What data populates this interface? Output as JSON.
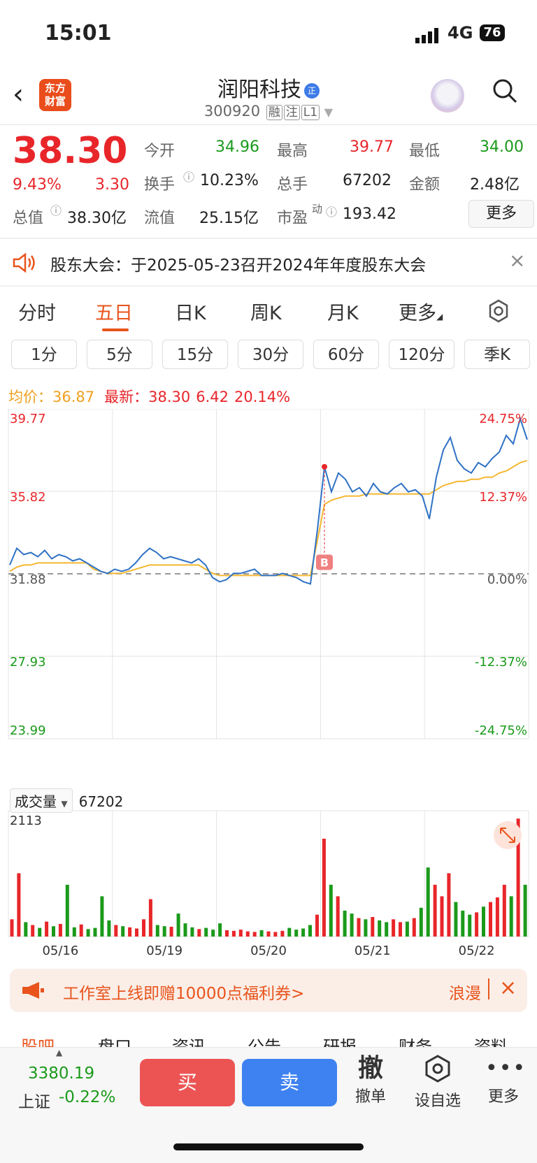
{
  "status": {
    "time": "15:01",
    "network": "4G",
    "battery": "76"
  },
  "header": {
    "logo_line1": "东方",
    "logo_line2": "财富",
    "title": "润阳科技",
    "title_badge": "正",
    "code": "300920",
    "tags": [
      "融",
      "注",
      "L1"
    ]
  },
  "quote": {
    "price": "38.30",
    "change_pct": "9.43%",
    "change": "3.30",
    "total_value_label": "总值",
    "total_value": "38.30亿",
    "open_label": "今开",
    "open": "34.96",
    "high_label": "最高",
    "high": "39.77",
    "low_label": "最低",
    "low": "34.00",
    "turnover_label": "换手",
    "turnover": "10.23%",
    "volume_label": "总手",
    "volume": "67202",
    "amount_label": "金额",
    "amount": "2.48亿",
    "float_label": "流值",
    "float_value": "25.15亿",
    "pe_label": "市盈",
    "pe_sup": "动",
    "pe": "193.42",
    "more": "更多"
  },
  "notice": {
    "text": "股东大会：于2025-05-23召开2024年年度股东大会"
  },
  "tabs": [
    "分时",
    "五日",
    "日K",
    "周K",
    "月K",
    "更多"
  ],
  "active_tab": "五日",
  "subtabs": [
    "1分",
    "5分",
    "15分",
    "30分",
    "60分",
    "120分",
    "季K"
  ],
  "legend": {
    "avg_label": "均价：",
    "avg": "36.87",
    "last_label": "最新：",
    "last": "38.30",
    "last_change": "6.42",
    "last_pct": "20.14%"
  },
  "colors": {
    "up": "#e8262a",
    "down": "#1b9a1b",
    "price_line": "#2f72c4",
    "avg_line": "#f5b731",
    "accent": "#e8541c"
  },
  "chart_data": {
    "type": "line",
    "title": "",
    "y_left_ticks": [
      "39.77",
      "35.82",
      "31.88",
      "27.93",
      "23.99"
    ],
    "y_right_ticks": [
      "24.75%",
      "12.37%",
      "0.00%",
      "-12.37%",
      "-24.75%"
    ],
    "ylim": [
      23.99,
      39.77
    ],
    "prev_close": 31.88,
    "x_labels": [
      "05/16",
      "05/19",
      "05/20",
      "05/21",
      "05/22"
    ],
    "series": [
      {
        "values": [
          32.3,
          33.1,
          32.8,
          32.9,
          32.7,
          33.0,
          32.6,
          32.8,
          32.7,
          32.5,
          32.6,
          32.4,
          32.2,
          32.0,
          31.9,
          32.1,
          32.0,
          32.1,
          32.4,
          32.8,
          33.1,
          32.9,
          32.6,
          32.7,
          32.6,
          32.5,
          32.4,
          32.6,
          32.3,
          31.7,
          31.5,
          31.6,
          31.9,
          31.9,
          32.0,
          32.1,
          31.8,
          31.8,
          31.8,
          31.9,
          31.8,
          31.7,
          31.5,
          31.4,
          34.0,
          37.0,
          35.8,
          36.7,
          36.4,
          35.8,
          36.0,
          35.6,
          36.2,
          35.8,
          35.7,
          36.0,
          36.2,
          35.8,
          35.9,
          35.6,
          34.5,
          36.5,
          37.8,
          38.4,
          37.3,
          36.9,
          36.7,
          37.2,
          37.0,
          37.4,
          37.7,
          38.5,
          38.1,
          39.3,
          38.3
        ]
      },
      {
        "values": [
          32.0,
          32.2,
          32.3,
          32.3,
          32.4,
          32.4,
          32.4,
          32.4,
          32.4,
          32.4,
          32.4,
          32.4,
          32.1,
          32.0,
          31.9,
          31.9,
          31.9,
          32.0,
          32.1,
          32.2,
          32.3,
          32.3,
          32.3,
          32.3,
          32.3,
          32.3,
          32.3,
          32.3,
          32.1,
          31.9,
          31.8,
          31.8,
          31.8,
          31.8,
          31.8,
          31.8,
          31.8,
          31.8,
          31.8,
          31.8,
          31.8,
          31.8,
          31.8,
          31.8,
          33.5,
          35.2,
          35.4,
          35.5,
          35.6,
          35.6,
          35.6,
          35.7,
          35.7,
          35.7,
          35.7,
          35.7,
          35.7,
          35.7,
          35.7,
          35.7,
          35.7,
          35.9,
          36.1,
          36.2,
          36.3,
          36.3,
          36.4,
          36.4,
          36.5,
          36.5,
          36.7,
          36.8,
          37.0,
          37.2,
          37.3
        ]
      }
    ],
    "marker": "B"
  },
  "volume": {
    "label": "成交量",
    "total": "67202",
    "max_tick": "2113",
    "chart_data": {
      "type": "bar",
      "ylim": [
        0,
        2113
      ],
      "values": [
        300,
        1100,
        250,
        200,
        150,
        260,
        180,
        220,
        900,
        160,
        210,
        130,
        150,
        700,
        280,
        200,
        180,
        160,
        140,
        300,
        650,
        200,
        180,
        170,
        400,
        230,
        160,
        130,
        150,
        120,
        230,
        110,
        100,
        120,
        90,
        80,
        110,
        90,
        80,
        100,
        150,
        120,
        140,
        200,
        380,
        1700,
        900,
        700,
        450,
        400,
        320,
        300,
        340,
        280,
        250,
        300,
        250,
        260,
        320,
        500,
        1200,
        900,
        700,
        1100,
        600,
        450,
        380,
        420,
        520,
        600,
        680,
        900,
        700,
        2050,
        900
      ]
    }
  },
  "banner": {
    "text": "工作室上线即赠10000点福利券>",
    "brand": "浪漫"
  },
  "bottom_tabs": [
    "股吧",
    "盘口",
    "资讯",
    "公告",
    "研报",
    "财务",
    "资料"
  ],
  "bottom_bar": {
    "index_value": "3380.19",
    "index_name": "上证",
    "index_change": "-0.22%",
    "buy": "买",
    "sell": "卖",
    "cancel_icon": "撤",
    "cancel": "撤单",
    "watch": "设自选",
    "more": "更多"
  }
}
